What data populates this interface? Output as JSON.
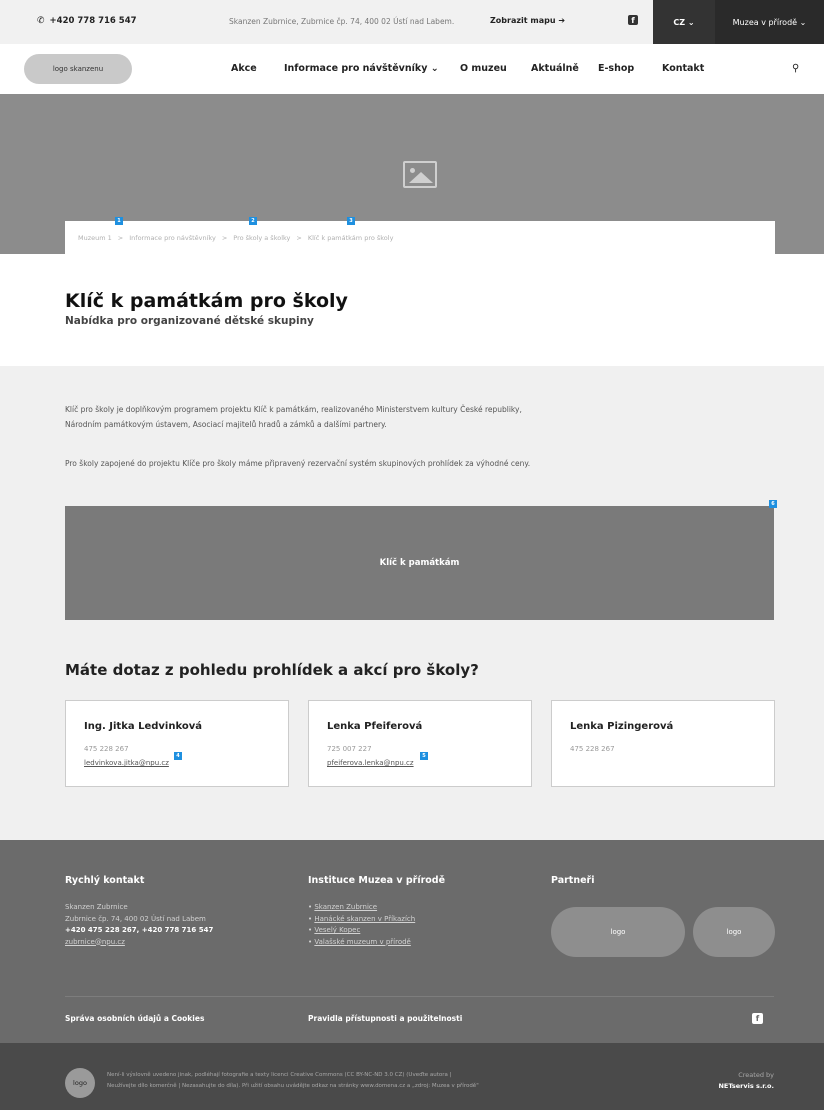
{
  "topbar": {
    "phone": "+420 778 716 547",
    "address": "Skanzen Zubrnice, Zubrnice čp. 74, 400 02 Ústí nad Labem.",
    "show_map": "Zobrazit mapu ➔",
    "fb_icon": "f",
    "lang": "CZ ⌄",
    "museums": "Muzea v přírodě ⌄"
  },
  "nav": {
    "logo": "logo skanzenu",
    "items": [
      "Akce",
      "Informace pro návštěvníky ⌄",
      "O muzeu",
      "Aktuálně",
      "E-shop",
      "Kontakt"
    ]
  },
  "breadcrumb": {
    "items": [
      "Muzeum 1",
      "Informace pro návštěvníky",
      "Pro školy a školky",
      "Klíč k památkám pro školy"
    ],
    "separator": ">",
    "badges": [
      "1",
      "2",
      "3"
    ]
  },
  "page": {
    "title": "Klíč k památkám pro školy",
    "subtitle": "Nabídka pro organizované dětské skupiny"
  },
  "content": {
    "para1_line1": "Klíč pro školy je doplňkovým programem projektu Klíč k památkám, realizovaného Ministerstvem kultury České republiky,",
    "para1_line2": "Národním památkovým ústavem, Asociací majitelů hradů a zámků a dalšími partnery.",
    "para2": "Pro školy zapojené do projektu Klíče pro školy máme připravený rezervační systém skupinových prohlídek za výhodné ceny.",
    "banner": "Klíč k památkám",
    "banner_badge": "6",
    "question": "Máte dotaz z pohledu prohlídek a akcí pro školy?",
    "contacts": [
      {
        "name": "Ing. Jitka Ledvinková",
        "phone": "475 228 267",
        "email": "ledvinkova.jitka@npu.cz",
        "badge": "4"
      },
      {
        "name": "Lenka Pfeiferová",
        "phone": "725 007 227",
        "email": "pfeiferova.lenka@npu.cz",
        "badge": "5"
      },
      {
        "name": "Lenka Pizingerová",
        "phone": "475 228 267",
        "email": "",
        "badge": ""
      }
    ]
  },
  "footer": {
    "quick_contact": {
      "heading": "Rychlý kontakt",
      "line1": "Skanzen Zubrnice",
      "line2": "Zubrnice čp. 74, 400 02 Ústí nad Labem",
      "line3": "+420 475 228 267, +420 778 716 547",
      "line4": "zubrnice@npu.cz"
    },
    "institutions": {
      "heading": "Instituce Muzea v přírodě",
      "items": [
        "Skanzen Zubrnice",
        "Hanácké skanzen v Příkazích",
        "Veselý Kopec",
        "Valašské muzeum v přírodě"
      ]
    },
    "partners": {
      "heading": "Partneři",
      "logo1": "logo",
      "logo2": "logo"
    },
    "privacy": "Správa osobních údajů a Cookies",
    "accessibility": "Pravidla přístupnosti a použitelnosti",
    "fb_icon": "f"
  },
  "bottombar": {
    "logo": "logo",
    "license_line1": "Není-li výslovně uvedeno jinak, podléhají fotografie a texty licenci Creative Commons (CC BY-NC-ND 3.0 CZ) (Uveďte autora |",
    "license_line2": "Neužívejte dílo komerčně | Nezasahujte do díla). Při užití obsahu uvádějte odkaz na stránky www.domena.cz a „zdroj: Muzea v přírodě\"",
    "created_by": "Created by",
    "company": "NETservis s.r.o."
  }
}
